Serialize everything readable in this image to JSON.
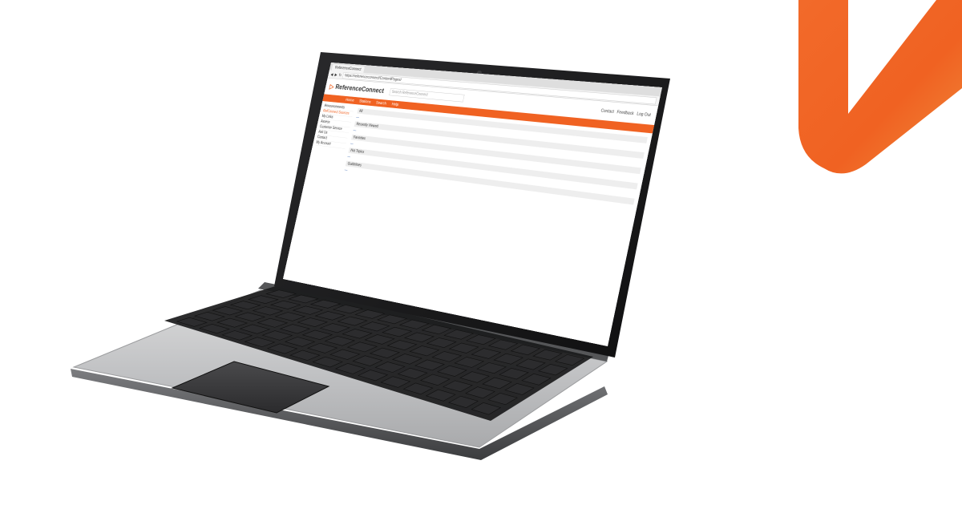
{
  "colors": {
    "brand": "#f06222",
    "background": "#ffffff"
  },
  "browser": {
    "tab_label": "ReferenceConnect",
    "address": "https://referenceconnect/ContentPages/"
  },
  "app": {
    "logo_text": "ReferenceConnect",
    "search_placeholder": "Search ReferenceConnect",
    "nav_items": [
      "Home",
      "Stations",
      "Search",
      "Help"
    ],
    "user_links": [
      "Contact",
      "Feedback",
      "Log Out"
    ]
  },
  "sidebar": {
    "items": [
      "Announcements",
      "RefConnect Sources",
      "My Links",
      "Assess",
      "Customer Service",
      "Ask Us",
      "Contact",
      "My Account"
    ]
  },
  "main": {
    "sections": [
      "All",
      "Recently Viewed",
      "Favorites",
      "Hot Topics",
      "Guidelines"
    ]
  }
}
